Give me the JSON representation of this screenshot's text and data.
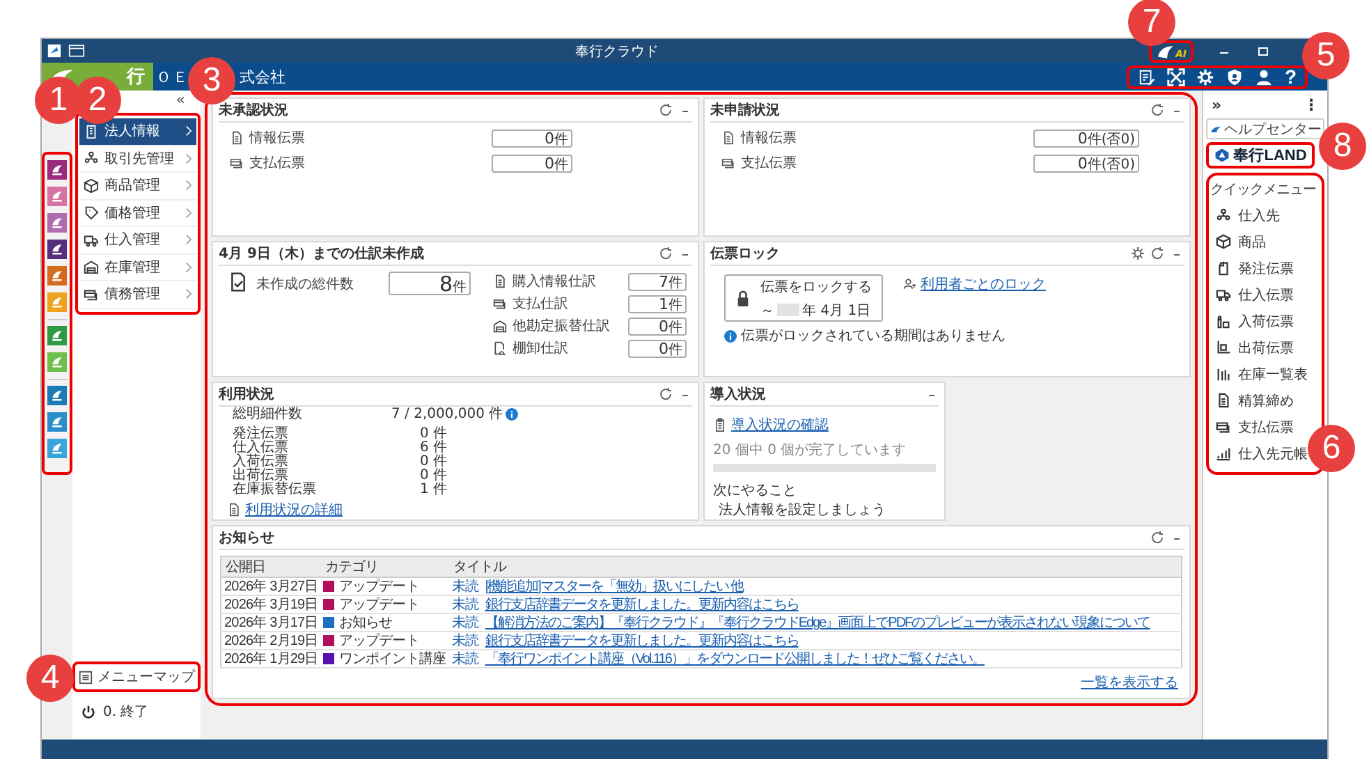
{
  "window": {
    "title": "奉行クラウド",
    "ai_label": "AI"
  },
  "header": {
    "logo_text": "行",
    "company_parts": [
      "ＯＥ",
      "式会社"
    ],
    "help_label": "?"
  },
  "callouts": [
    "1",
    "2",
    "3",
    "4",
    "5",
    "6",
    "7",
    "8"
  ],
  "app_rail": {
    "groups": [
      [
        {
          "color": "#9b2a7f"
        },
        {
          "color": "#d873a6"
        },
        {
          "color": "#b06cb0"
        },
        {
          "color": "#56307e"
        },
        {
          "color": "#d46b1e"
        },
        {
          "color": "#eea21f"
        }
      ],
      [
        {
          "color": "#2e9a44"
        },
        {
          "color": "#6cbf4a"
        }
      ],
      [
        {
          "color": "#1a7bb5"
        },
        {
          "color": "#2a8fc8"
        },
        {
          "color": "#3aa5da"
        }
      ]
    ]
  },
  "nav": {
    "collapse": "«",
    "items": [
      {
        "label": "法人情報",
        "selected": true
      },
      {
        "label": "取引先管理",
        "selected": false
      },
      {
        "label": "商品管理",
        "selected": false
      },
      {
        "label": "価格管理",
        "selected": false
      },
      {
        "label": "仕入管理",
        "selected": false
      },
      {
        "label": "在庫管理",
        "selected": false
      },
      {
        "label": "債務管理",
        "selected": false
      }
    ]
  },
  "menu_map": "メニューマップ",
  "exit": "0. 終了",
  "unapproved": {
    "title": "未承認状況",
    "rows": [
      {
        "label": "情報伝票",
        "value": "0",
        "unit": "件"
      },
      {
        "label": "支払伝票",
        "value": "0",
        "unit": "件"
      }
    ]
  },
  "unsubmitted": {
    "title": "未申請状況",
    "rows": [
      {
        "label": "情報伝票",
        "value": "0",
        "unit": "件(否0)"
      },
      {
        "label": "支払伝票",
        "value": "0",
        "unit": "件(否0)"
      }
    ]
  },
  "pending": {
    "title": "4月 9日（木）までの仕訳未作成",
    "total": {
      "label": "未作成の総件数",
      "value": "8",
      "unit": "件"
    },
    "rows": [
      {
        "label": "購入情報仕訳",
        "value": "7",
        "unit": "件"
      },
      {
        "label": "支払仕訳",
        "value": "1",
        "unit": "件"
      },
      {
        "label": "他勘定振替仕訳",
        "value": "0",
        "unit": "件"
      },
      {
        "label": "棚卸仕訳",
        "value": "0",
        "unit": "件"
      }
    ]
  },
  "slip_lock": {
    "title": "伝票ロック",
    "button_label": "伝票をロックする",
    "range_prefix": "～",
    "range_date": "年 4月 1日",
    "user_link": "利用者ごとのロック",
    "info": "伝票がロックされている期間はありません"
  },
  "usage": {
    "title": "利用状況",
    "total": {
      "label": "総明細件数",
      "value": "7 / 2,000,000 件"
    },
    "rows": [
      {
        "label": "発注伝票",
        "value": "0 件"
      },
      {
        "label": "仕入伝票",
        "value": "6 件"
      },
      {
        "label": "入荷伝票",
        "value": "0 件"
      },
      {
        "label": "出荷伝票",
        "value": "0 件"
      },
      {
        "label": "在庫振替伝票",
        "value": "1 件"
      }
    ],
    "detail_link": "利用状況の詳細"
  },
  "onboarding": {
    "title": "導入状況",
    "check_link": "導入状況の確認",
    "progress_text": "20 個中 0 個が完了しています",
    "level": 0,
    "next_label": "次にやること",
    "next_item": "法人情報を設定しましょう"
  },
  "notices": {
    "title": "お知らせ",
    "columns": [
      "公開日",
      "カテゴリ",
      "タイトル"
    ],
    "rows": [
      {
        "date": "2026年 3月27日",
        "category": "アップデート",
        "color": "#b0105a",
        "status": "未読",
        "title": "[機能追加]マスターを「無効」扱いにしたい 他"
      },
      {
        "date": "2026年 3月19日",
        "category": "アップデート",
        "color": "#b0105a",
        "status": "未読",
        "title": "銀行支店辞書データを更新しました。更新内容はこちら"
      },
      {
        "date": "2026年 3月17日",
        "category": "お知らせ",
        "color": "#1a6fc0",
        "status": "未読",
        "title": "【解消方法のご案内】『奉行クラウド』『奉行クラウドEdge』画面上でPDFのプレビューが表示されない現象について"
      },
      {
        "date": "2026年 2月19日",
        "category": "アップデート",
        "color": "#b0105a",
        "status": "未読",
        "title": "銀行支店辞書データを更新しました。更新内容はこちら"
      },
      {
        "date": "2026年 1月29日",
        "category": "ワンポイント講座",
        "color": "#5a10b0",
        "status": "未読",
        "title": "「奉行ワンポイント講座（Vol.116）」をダウンロード公開しました！ぜひご覧ください。"
      }
    ],
    "more_link": "一覧を表示する"
  },
  "right_panel": {
    "expand": "»",
    "more": "⋮",
    "help_center": "ヘルプセンター",
    "land": "奉行LAND",
    "quick_menu": {
      "title": "クイックメニュー",
      "items": [
        "仕入先",
        "商品",
        "発注伝票",
        "仕入伝票",
        "入荷伝票",
        "出荷伝票",
        "在庫一覧表",
        "精算締め",
        "支払伝票",
        "仕入先元帳"
      ]
    }
  }
}
